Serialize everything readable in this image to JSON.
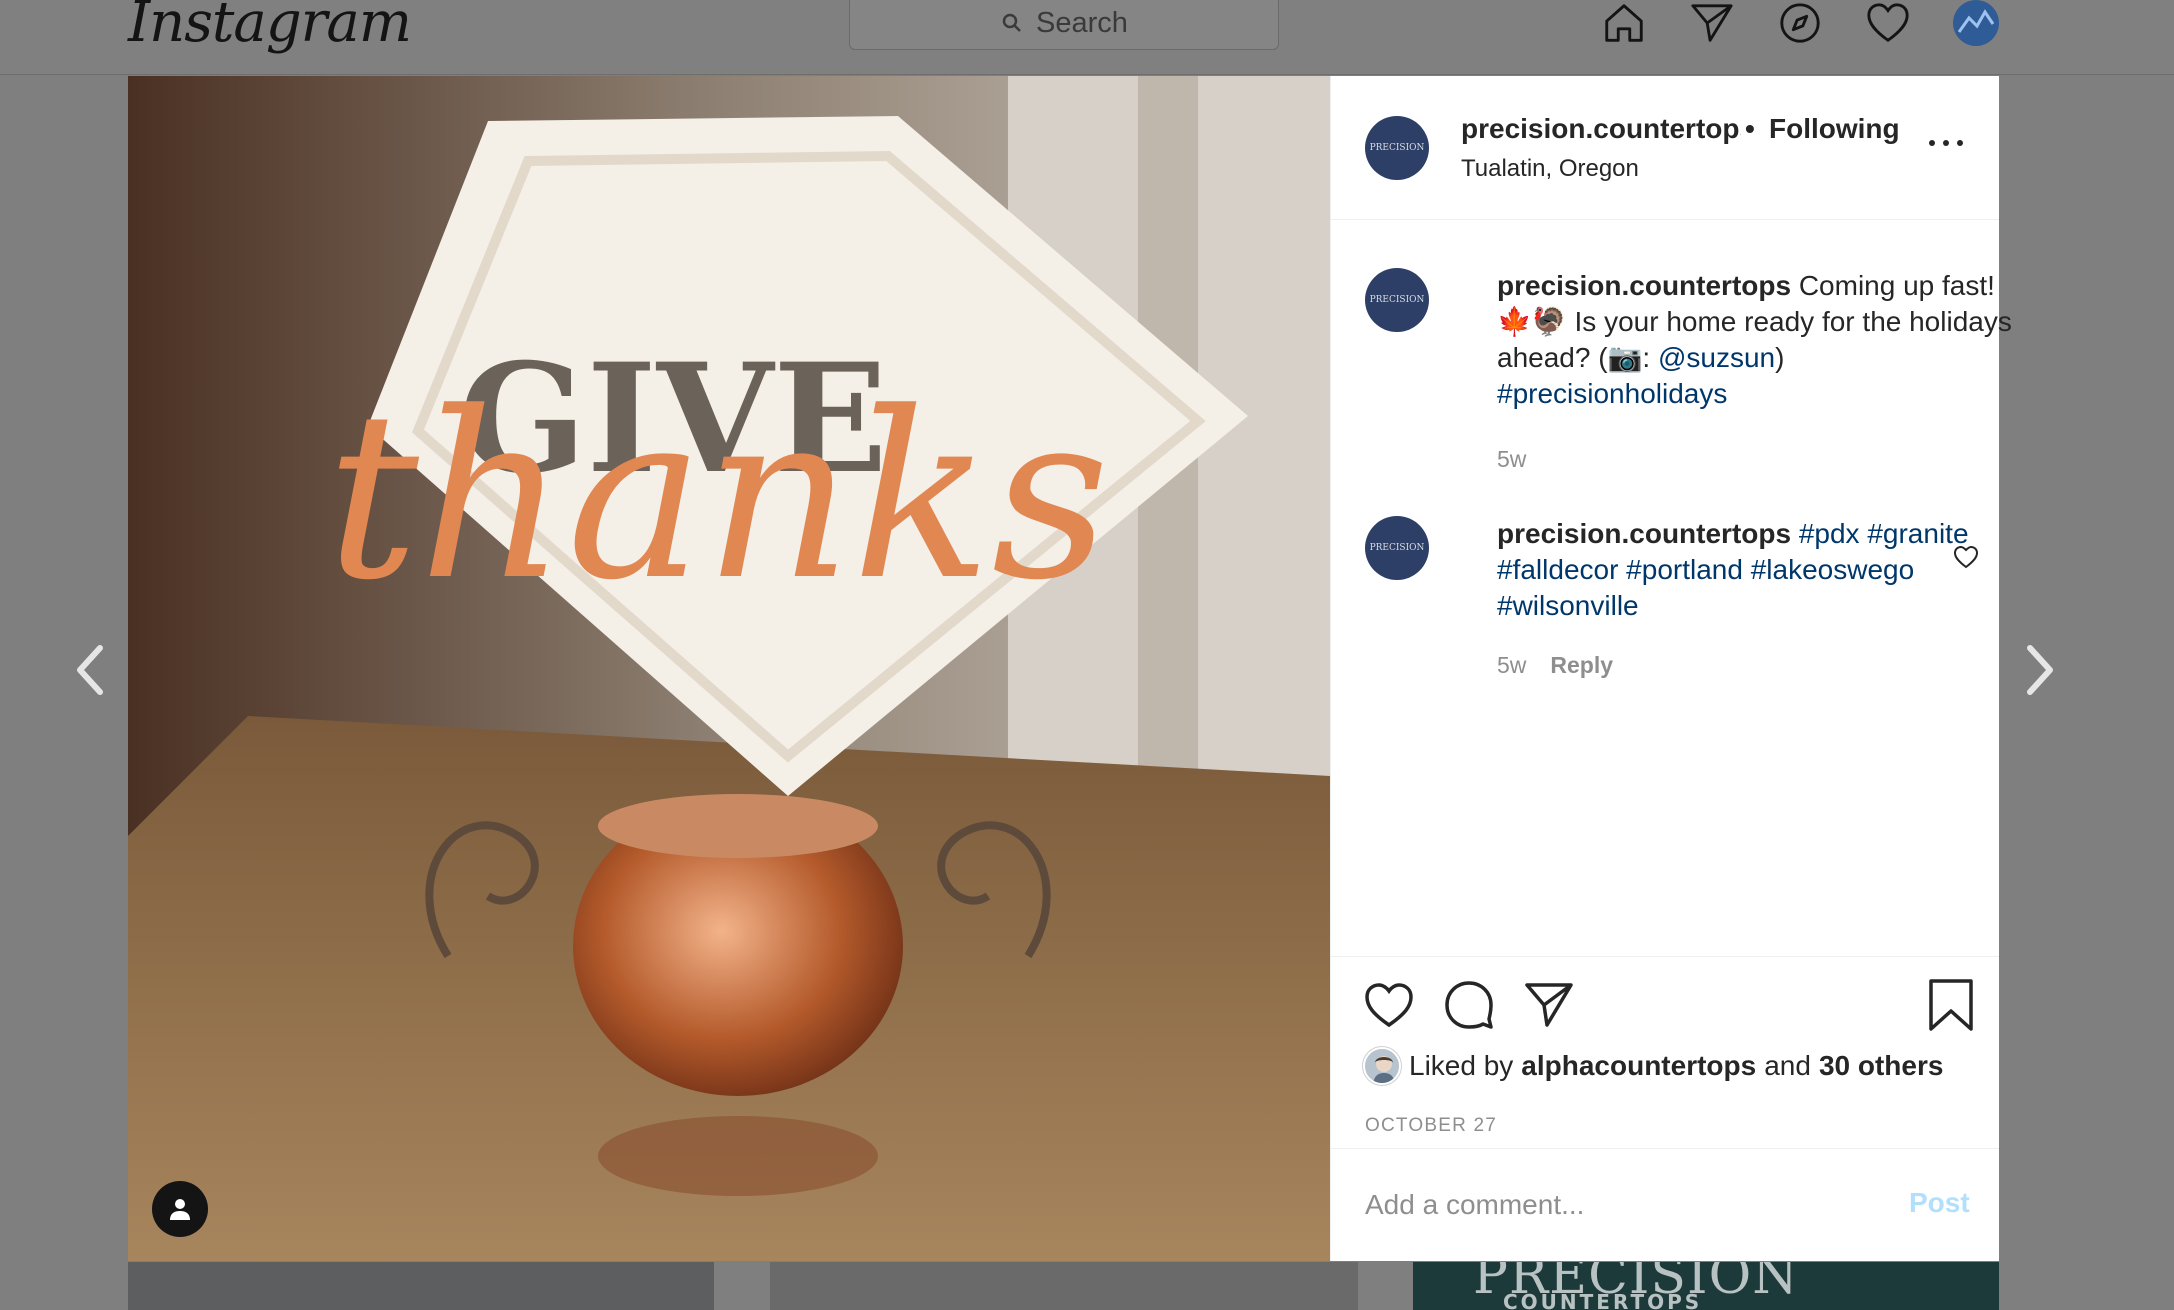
{
  "topbar": {
    "logo": "Instagram",
    "search_placeholder": "Search",
    "icons": [
      "home-icon",
      "direct-icon",
      "explore-icon",
      "activity-heart-icon",
      "profile-avatar"
    ]
  },
  "post": {
    "header": {
      "username": "precision.countertops",
      "separator": "•",
      "follow_state": "Following",
      "location": "Tualatin, Oregon"
    },
    "avatar_text": "PRECISION",
    "caption": {
      "username": "precision.countertops",
      "text_1": "Coming up fast!",
      "text_2": "🍁🦃 Is your home ready for the holidays ahead? (📷: ",
      "mention": "@suzsun",
      "text_3": ")",
      "hashtag": "#precisionholidays",
      "age": "5w"
    },
    "comment": {
      "username": "precision.countertops",
      "hashtags": "#pdx #granite #falldecor #portland #lakeoswego #wilsonville",
      "age": "5w",
      "reply_label": "Reply"
    },
    "likes": {
      "prefix": "Liked by",
      "user": "alphacountertops",
      "conj": "and",
      "others": "30 others"
    },
    "date": "OCTOBER 27",
    "comment_box": {
      "placeholder": "Add a comment...",
      "post_label": "Post"
    }
  },
  "photo": {
    "description_words": [
      "GIVE",
      "thanks"
    ]
  },
  "background": {
    "brand_1": "PRECISION",
    "brand_2": "COUNTERTOPS"
  },
  "colors": {
    "link": "#00376b",
    "muted": "#8e8e8e",
    "post_disabled": "#b2dffc",
    "avatar_bg": "#2d3f66"
  }
}
